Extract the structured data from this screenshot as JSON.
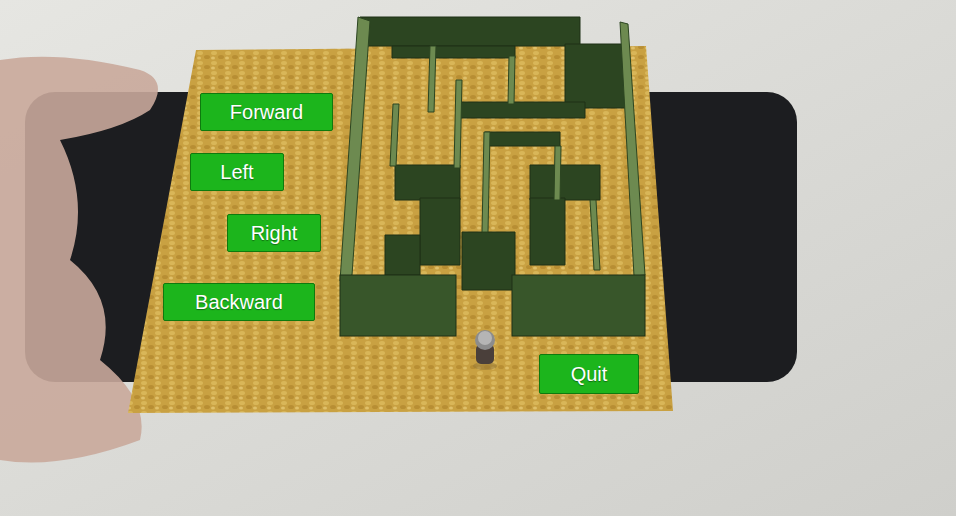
{
  "controls": [
    {
      "label": "Forward"
    },
    {
      "label": "Left"
    },
    {
      "label": "Right"
    },
    {
      "label": "Backward"
    }
  ],
  "quit": {
    "label": "Quit"
  }
}
